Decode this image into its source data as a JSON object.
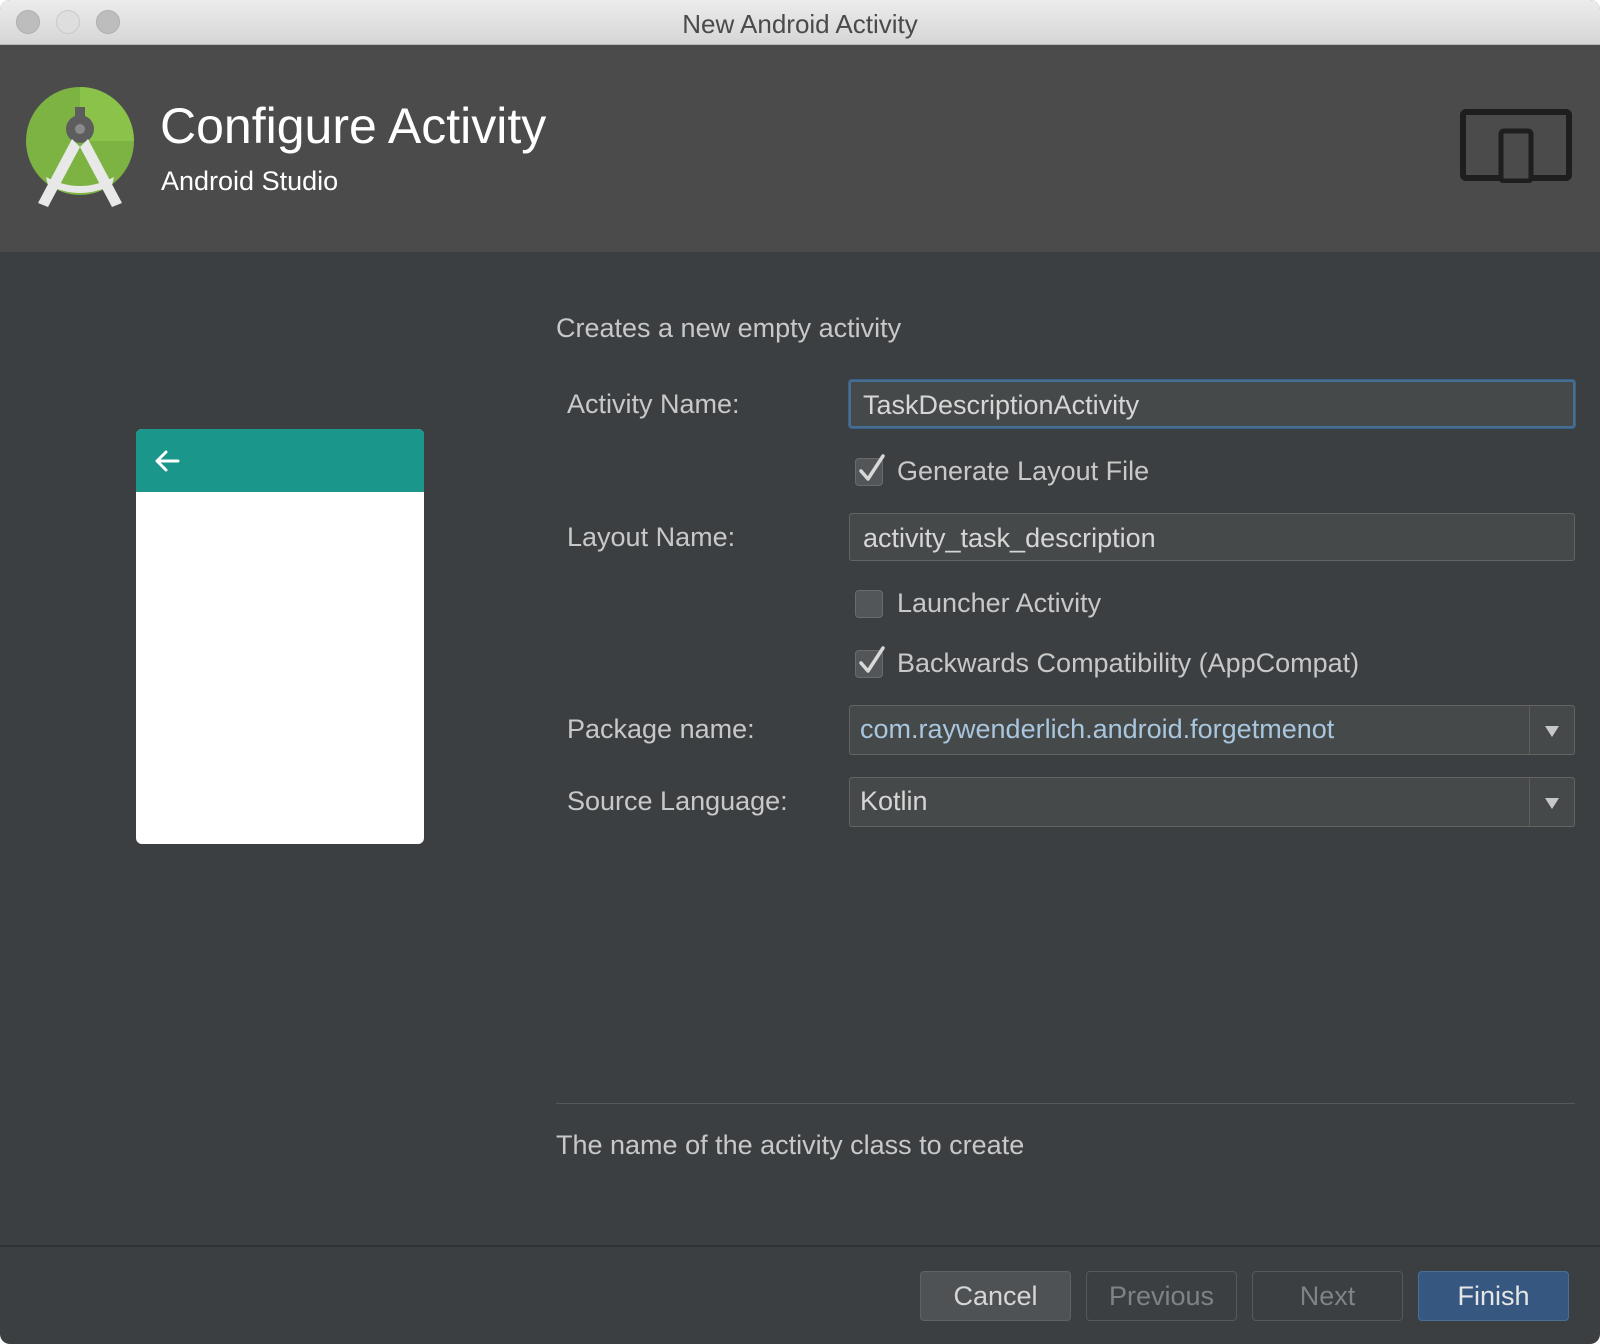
{
  "window": {
    "title": "New Android Activity"
  },
  "header": {
    "title": "Configure Activity",
    "subtitle": "Android Studio"
  },
  "form": {
    "description": "Creates a new empty activity",
    "activity_name": {
      "label": "Activity Name:",
      "value": "TaskDescriptionActivity"
    },
    "generate_layout": {
      "label": "Generate Layout File",
      "checked": true
    },
    "layout_name": {
      "label": "Layout Name:",
      "value": "activity_task_description"
    },
    "launcher_activity": {
      "label": "Launcher Activity",
      "checked": false
    },
    "backwards_compat": {
      "label": "Backwards Compatibility (AppCompat)",
      "checked": true
    },
    "package_name": {
      "label": "Package name:",
      "value": "com.raywenderlich.android.forgetmenot"
    },
    "source_language": {
      "label": "Source Language:",
      "value": "Kotlin"
    }
  },
  "help_text": "The name of the activity class to create",
  "buttons": {
    "cancel": "Cancel",
    "previous": "Previous",
    "next": "Next",
    "finish": "Finish"
  },
  "colors": {
    "accent": "#1a968a",
    "package_text": "#a9c6de",
    "focus_border": "#466d94",
    "primary_button": "#365880"
  }
}
